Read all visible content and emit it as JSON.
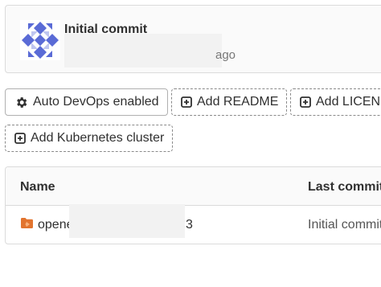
{
  "commit": {
    "title": "Initial commit",
    "time_suffix": "ago"
  },
  "actions": {
    "auto_devops": "Auto DevOps enabled",
    "add_readme": "Add README",
    "add_license": "Add LICENSE",
    "add_k8s": "Add Kubernetes cluster"
  },
  "table": {
    "headers": {
      "name": "Name",
      "last_commit": "Last commit"
    },
    "rows": [
      {
        "name_prefix": "opene",
        "name_suffix": "3",
        "last_commit": "Initial commit"
      }
    ]
  },
  "icons": {
    "avatar": "identicon-avatar",
    "gear": "gear-icon",
    "plus_square": "plus-square-icon",
    "folder": "folder-icon"
  },
  "colors": {
    "avatar_blue": "#5a6bd6",
    "folder_orange": "#e2742e"
  }
}
